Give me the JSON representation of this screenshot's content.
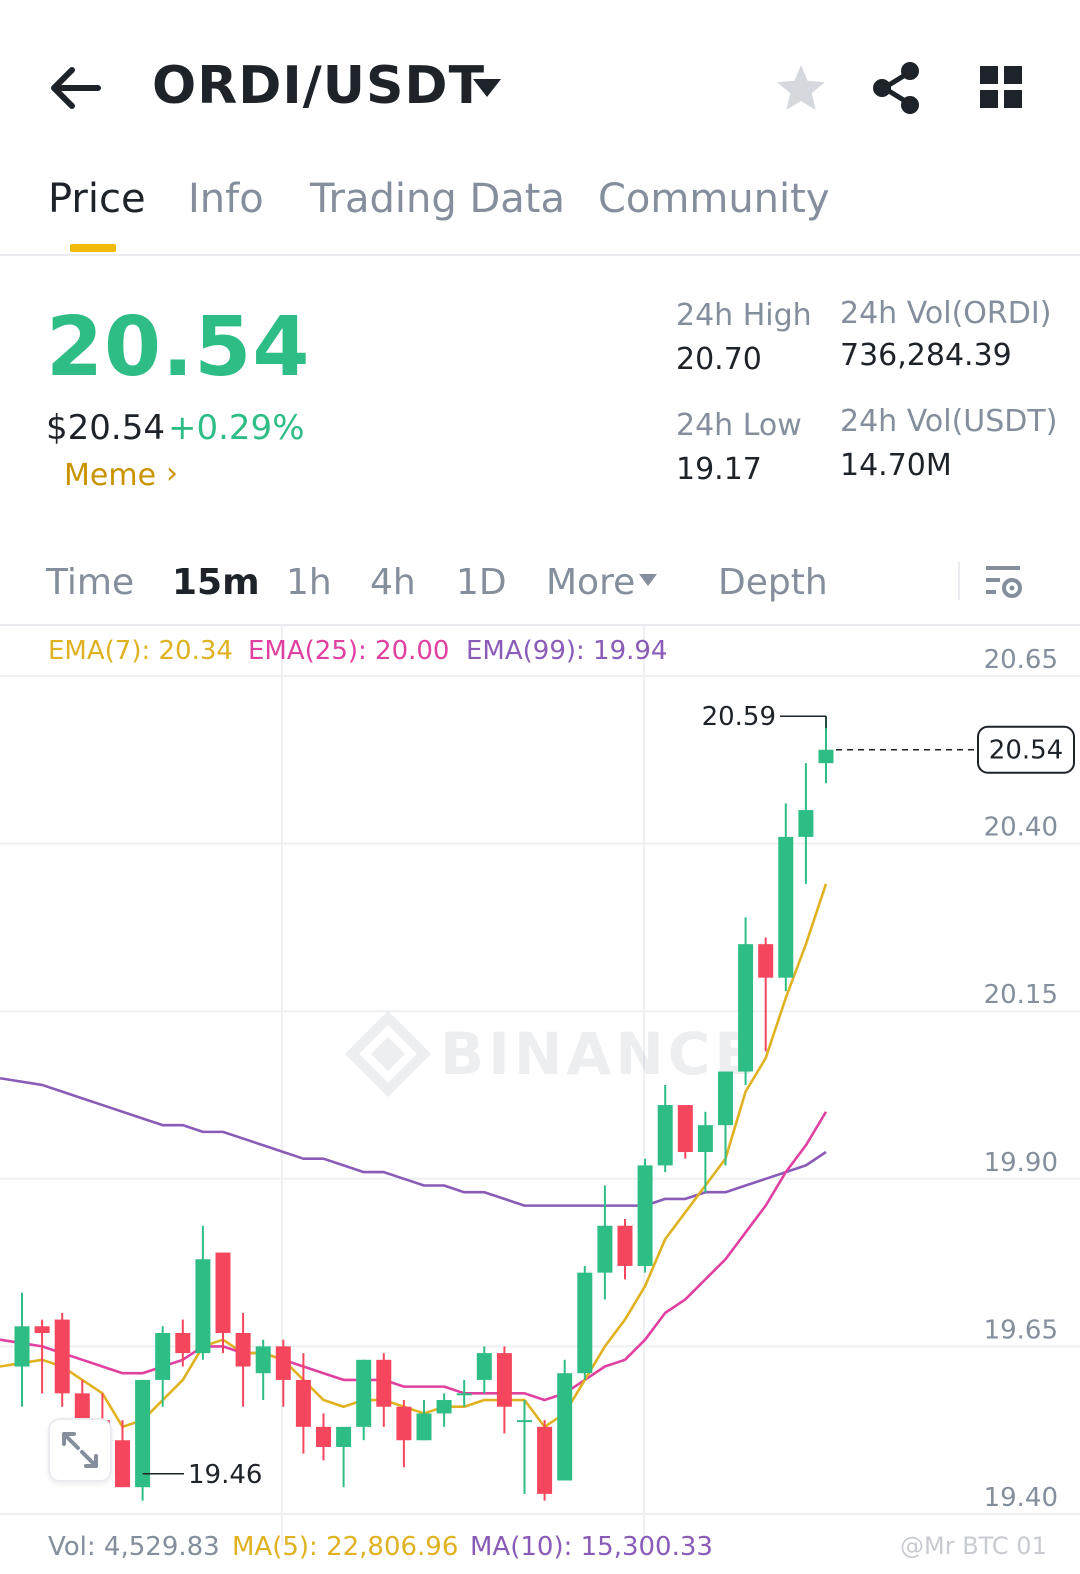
{
  "header": {
    "pair": "ORDI/USDT",
    "icons": {
      "back": "back-arrow-icon",
      "dropdown": "caret-down-icon",
      "favorite": "star-icon",
      "share": "share-icon",
      "apps": "grid-icon"
    }
  },
  "tabs": [
    {
      "label": "Price",
      "active": true
    },
    {
      "label": "Info",
      "active": false
    },
    {
      "label": "Trading Data",
      "active": false
    },
    {
      "label": "Community",
      "active": false
    }
  ],
  "ticker": {
    "last_price": "20.54",
    "usd_price": "$20.54",
    "change": "+0.29%",
    "tag": "Meme",
    "tag_chevron": "›",
    "stats": {
      "high_label": "24h High",
      "high_value": "20.70",
      "low_label": "24h Low",
      "low_value": "19.17",
      "vol_base_label": "24h Vol(ORDI)",
      "vol_base_value": "736,284.39",
      "vol_quote_label": "24h Vol(USDT)",
      "vol_quote_value": "14.70M"
    }
  },
  "timeframes": {
    "items": [
      "Time",
      "15m",
      "1h",
      "4h",
      "1D",
      "More",
      "Depth"
    ],
    "active": "15m"
  },
  "indicators": {
    "ema7": "EMA(7): 20.34",
    "ema25": "EMA(25): 20.00",
    "ema99": "EMA(99): 19.94"
  },
  "volume_row": {
    "vol": "Vol: 4,529.83",
    "ma5": "MA(5): 22,806.96",
    "ma10": "MA(10): 15,300.33"
  },
  "watermark": "BINANCE",
  "credit": "@Mr BTC 01",
  "colors": {
    "up": "#2ebd85",
    "down": "#f6465d",
    "ema7": "#e0b121",
    "ema25": "#e040a0",
    "ema99": "#8a5cb8",
    "accent": "#f0b90b"
  },
  "chart_data": {
    "type": "candlestick",
    "y_ticks": [
      20.65,
      20.4,
      20.15,
      19.9,
      19.65,
      19.4
    ],
    "ylim": [
      19.4,
      20.65
    ],
    "high_marker": "20.59",
    "low_marker": "19.46",
    "last_price_marker": "20.54",
    "candles": [
      {
        "o": 19.62,
        "h": 19.73,
        "l": 19.56,
        "c": 19.68
      },
      {
        "o": 19.68,
        "h": 19.69,
        "l": 19.58,
        "c": 19.67
      },
      {
        "o": 19.69,
        "h": 19.7,
        "l": 19.56,
        "c": 19.58
      },
      {
        "o": 19.58,
        "h": 19.6,
        "l": 19.51,
        "c": 19.54
      },
      {
        "o": 19.54,
        "h": 19.58,
        "l": 19.47,
        "c": 19.52
      },
      {
        "o": 19.51,
        "h": 19.54,
        "l": 19.44,
        "c": 19.44
      },
      {
        "o": 19.44,
        "h": 19.6,
        "l": 19.42,
        "c": 19.6
      },
      {
        "o": 19.6,
        "h": 19.68,
        "l": 19.56,
        "c": 19.67
      },
      {
        "o": 19.67,
        "h": 19.69,
        "l": 19.62,
        "c": 19.64
      },
      {
        "o": 19.64,
        "h": 19.83,
        "l": 19.63,
        "c": 19.78
      },
      {
        "o": 19.79,
        "h": 19.79,
        "l": 19.64,
        "c": 19.67
      },
      {
        "o": 19.67,
        "h": 19.7,
        "l": 19.56,
        "c": 19.62
      },
      {
        "o": 19.61,
        "h": 19.66,
        "l": 19.57,
        "c": 19.65
      },
      {
        "o": 19.65,
        "h": 19.66,
        "l": 19.56,
        "c": 19.6
      },
      {
        "o": 19.6,
        "h": 19.64,
        "l": 19.49,
        "c": 19.53
      },
      {
        "o": 19.53,
        "h": 19.55,
        "l": 19.48,
        "c": 19.5
      },
      {
        "o": 19.5,
        "h": 19.52,
        "l": 19.44,
        "c": 19.53
      },
      {
        "o": 19.53,
        "h": 19.63,
        "l": 19.51,
        "c": 19.63
      },
      {
        "o": 19.63,
        "h": 19.64,
        "l": 19.53,
        "c": 19.56
      },
      {
        "o": 19.56,
        "h": 19.57,
        "l": 19.47,
        "c": 19.51
      },
      {
        "o": 19.51,
        "h": 19.57,
        "l": 19.51,
        "c": 19.55
      },
      {
        "o": 19.55,
        "h": 19.58,
        "l": 19.53,
        "c": 19.57
      },
      {
        "o": 19.58,
        "h": 19.6,
        "l": 19.56,
        "c": 19.58
      },
      {
        "o": 19.6,
        "h": 19.65,
        "l": 19.58,
        "c": 19.64
      },
      {
        "o": 19.64,
        "h": 19.65,
        "l": 19.52,
        "c": 19.56
      },
      {
        "o": 19.54,
        "h": 19.57,
        "l": 19.43,
        "c": 19.54
      },
      {
        "o": 19.53,
        "h": 19.54,
        "l": 19.42,
        "c": 19.43
      },
      {
        "o": 19.45,
        "h": 19.63,
        "l": 19.45,
        "c": 19.61
      },
      {
        "o": 19.61,
        "h": 19.77,
        "l": 19.6,
        "c": 19.76
      },
      {
        "o": 19.76,
        "h": 19.89,
        "l": 19.72,
        "c": 19.83
      },
      {
        "o": 19.83,
        "h": 19.84,
        "l": 19.75,
        "c": 19.77
      },
      {
        "o": 19.77,
        "h": 19.93,
        "l": 19.76,
        "c": 19.92
      },
      {
        "o": 19.92,
        "h": 20.04,
        "l": 19.91,
        "c": 20.01
      },
      {
        "o": 20.01,
        "h": 20.01,
        "l": 19.93,
        "c": 19.94
      },
      {
        "o": 19.94,
        "h": 20.0,
        "l": 19.88,
        "c": 19.98
      },
      {
        "o": 19.98,
        "h": 20.03,
        "l": 19.92,
        "c": 20.06
      },
      {
        "o": 20.06,
        "h": 20.29,
        "l": 20.04,
        "c": 20.25
      },
      {
        "o": 20.25,
        "h": 20.26,
        "l": 20.09,
        "c": 20.2
      },
      {
        "o": 20.2,
        "h": 20.46,
        "l": 20.18,
        "c": 20.41
      },
      {
        "o": 20.41,
        "h": 20.52,
        "l": 20.34,
        "c": 20.45
      },
      {
        "o": 20.52,
        "h": 20.59,
        "l": 20.49,
        "c": 20.54
      }
    ],
    "ema7": [
      19.62,
      19.63,
      19.62,
      19.6,
      19.58,
      19.53,
      19.54,
      19.57,
      19.6,
      19.65,
      19.66,
      19.64,
      19.64,
      19.63,
      19.6,
      19.57,
      19.56,
      19.57,
      19.57,
      19.56,
      19.55,
      19.56,
      19.56,
      19.57,
      19.57,
      19.57,
      19.53,
      19.55,
      19.6,
      19.65,
      19.69,
      19.74,
      19.81,
      19.85,
      19.89,
      19.93,
      20.03,
      20.08,
      20.17,
      20.25,
      20.34
    ],
    "ema25": [
      19.66,
      19.65,
      19.64,
      19.63,
      19.62,
      19.61,
      19.61,
      19.62,
      19.63,
      19.65,
      19.65,
      19.64,
      19.64,
      19.63,
      19.62,
      19.61,
      19.6,
      19.6,
      19.6,
      19.59,
      19.59,
      19.59,
      19.58,
      19.58,
      19.58,
      19.58,
      19.57,
      19.58,
      19.6,
      19.62,
      19.63,
      19.66,
      19.7,
      19.72,
      19.75,
      19.78,
      19.82,
      19.86,
      19.91,
      19.95,
      20.0
    ],
    "ema99": [
      20.05,
      20.04,
      20.03,
      20.02,
      20.01,
      20.0,
      19.99,
      19.98,
      19.98,
      19.97,
      19.97,
      19.96,
      19.95,
      19.94,
      19.93,
      19.93,
      19.92,
      19.91,
      19.91,
      19.9,
      19.89,
      19.89,
      19.88,
      19.88,
      19.87,
      19.86,
      19.86,
      19.86,
      19.86,
      19.86,
      19.86,
      19.86,
      19.87,
      19.87,
      19.88,
      19.88,
      19.89,
      19.9,
      19.91,
      19.92,
      19.94
    ]
  }
}
